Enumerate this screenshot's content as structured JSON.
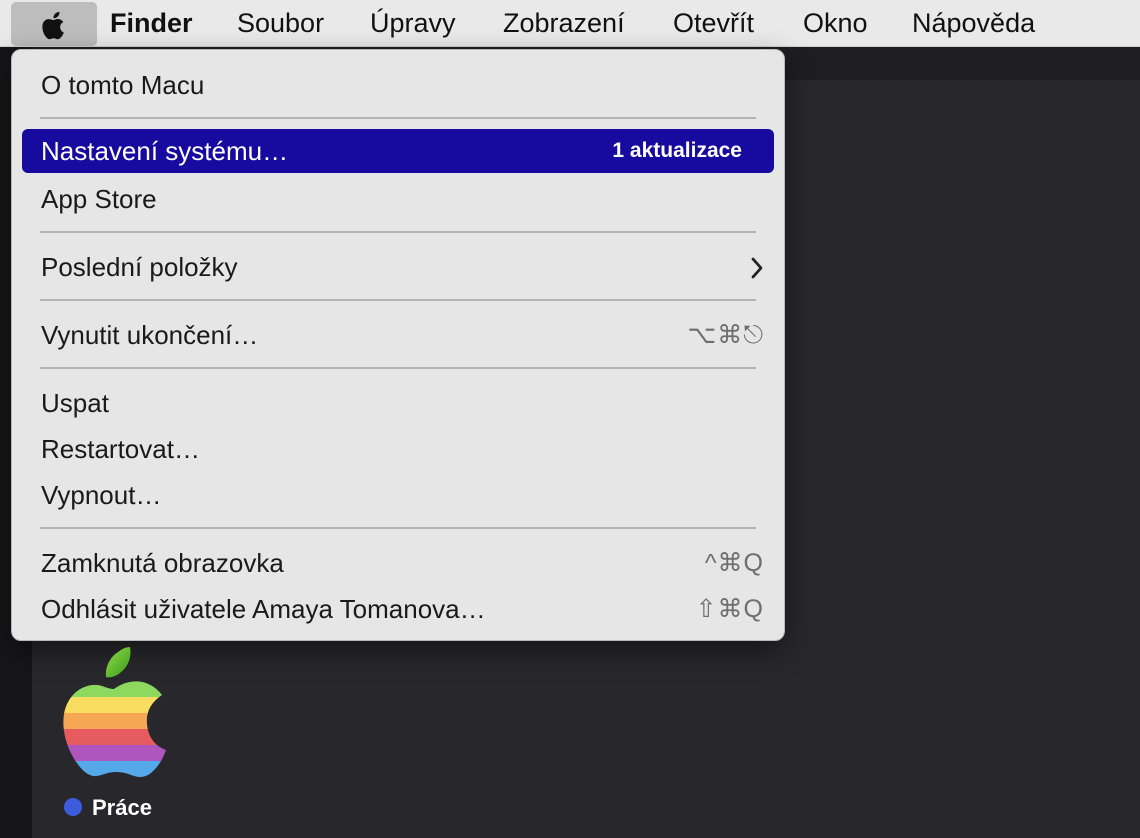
{
  "menubar": {
    "apple_icon": "apple-logo-icon",
    "app_name": "Finder",
    "items": [
      "Soubor",
      "Úpravy",
      "Zobrazení",
      "Otevřít",
      "Okno",
      "Nápověda"
    ]
  },
  "apple_menu": {
    "about": "O tomto Macu",
    "settings": "Nastavení systému…",
    "settings_badge": "1 aktualizace",
    "app_store": "App Store",
    "recent": "Poslední položky",
    "recent_icon": "chevron-right-icon",
    "force_quit": "Vynutit ukončení…",
    "force_quit_shortcut": "⌥⌘⎋",
    "sleep": "Uspat",
    "restart": "Restartovat…",
    "shutdown": "Vypnout…",
    "lock": "Zamknutá obrazovka",
    "lock_shortcut": "^⌘Q",
    "logout": "Odhlásit uživatele Amaya Tomanova…",
    "logout_shortcut": "⇧⌘Q"
  },
  "desktop": {
    "icon": "rainbow-apple-icon",
    "label": "Práce",
    "tag_color": "#3c5cdc"
  },
  "colors": {
    "selection": "#170a9f",
    "menu_background": "#e6e6e6"
  }
}
